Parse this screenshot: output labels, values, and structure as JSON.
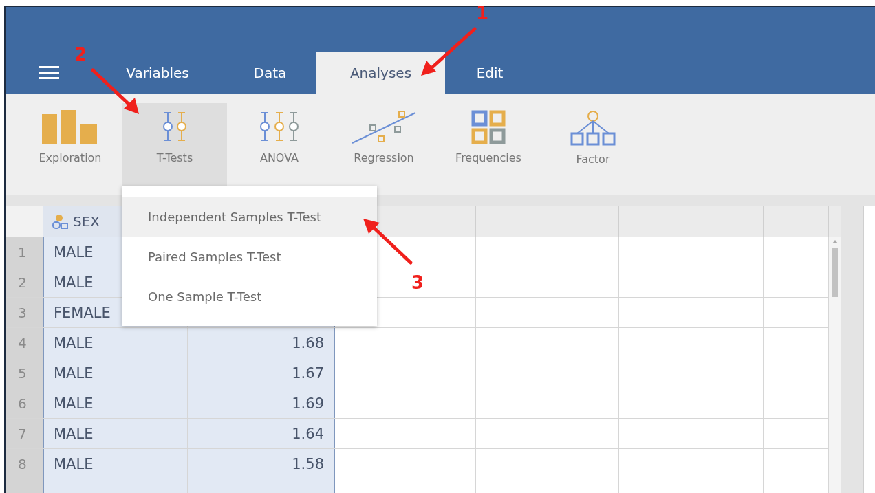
{
  "tabs": [
    {
      "label": "Variables",
      "selected": false
    },
    {
      "label": "Data",
      "selected": false
    },
    {
      "label": "Analyses",
      "selected": true
    },
    {
      "label": "Edit",
      "selected": false
    }
  ],
  "ribbon": [
    {
      "kind": "exploration",
      "label": "Exploration",
      "selected": false
    },
    {
      "kind": "ttests",
      "label": "T-Tests",
      "selected": true
    },
    {
      "kind": "anova",
      "label": "ANOVA",
      "selected": false
    },
    {
      "kind": "regression",
      "label": "Regression",
      "selected": false
    },
    {
      "kind": "frequencies",
      "label": "Frequencies",
      "selected": false
    },
    {
      "kind": "factor",
      "label": "Factor",
      "selected": false
    }
  ],
  "menu": [
    {
      "label": "Independent Samples T-Test",
      "selected": true
    },
    {
      "label": "Paired Samples T-Test",
      "selected": false
    },
    {
      "label": "One Sample T-Test",
      "selected": false
    }
  ],
  "columns": [
    {
      "name": "SEX",
      "selected": true
    },
    {
      "selected": true
    },
    {
      "selected": false
    },
    {
      "selected": false
    },
    {
      "selected": false
    },
    {
      "selected": false
    }
  ],
  "rows": [
    {
      "number": "1",
      "values": [
        "MALE"
      ]
    },
    {
      "number": "2",
      "values": [
        "MALE"
      ]
    },
    {
      "number": "3",
      "values": [
        "FEMALE"
      ]
    },
    {
      "number": "4",
      "values": [
        "MALE",
        "1.68"
      ]
    },
    {
      "number": "5",
      "values": [
        "MALE",
        "1.67"
      ]
    },
    {
      "number": "6",
      "values": [
        "MALE",
        "1.69"
      ]
    },
    {
      "number": "7",
      "values": [
        "MALE",
        "1.64"
      ]
    },
    {
      "number": "8",
      "values": [
        "MALE",
        "1.58"
      ]
    }
  ],
  "annotations": [
    {
      "label": "1"
    },
    {
      "label": "2"
    },
    {
      "label": "3"
    }
  ]
}
